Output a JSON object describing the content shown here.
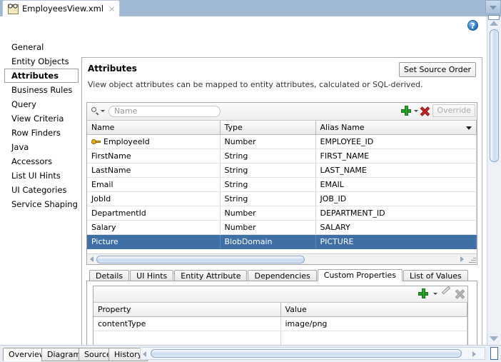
{
  "window": {
    "document_tab": {
      "label": "EmployeesView.xml",
      "icon": "view-object-icon",
      "close_label": "×"
    },
    "help_label": "?"
  },
  "sidebar": {
    "items": [
      {
        "label": "General",
        "selected": false
      },
      {
        "label": "Entity Objects",
        "selected": false
      },
      {
        "label": "Attributes",
        "selected": true
      },
      {
        "label": "Business Rules",
        "selected": false
      },
      {
        "label": "Query",
        "selected": false
      },
      {
        "label": "View Criteria",
        "selected": false
      },
      {
        "label": "Row Finders",
        "selected": false
      },
      {
        "label": "Java",
        "selected": false
      },
      {
        "label": "Accessors",
        "selected": false
      },
      {
        "label": "List UI Hints",
        "selected": false
      },
      {
        "label": "UI Categories",
        "selected": false
      },
      {
        "label": "Service Shaping",
        "selected": false
      }
    ]
  },
  "panel": {
    "title": "Attributes",
    "description": "View object attributes can be mapped to entity attributes, calculated or SQL-derived.",
    "set_source_order_label": "Set Source Order"
  },
  "attributes_toolbar": {
    "search_placeholder": "Name",
    "search_value": "",
    "add_label": "+",
    "delete_label": "×",
    "override_label": "Override",
    "override_enabled": false
  },
  "attributes_table": {
    "columns": [
      "Name",
      "Type",
      "Alias Name"
    ],
    "rows": [
      {
        "name": "EmployeeId",
        "type": "Number",
        "alias": "EMPLOYEE_ID",
        "key": true,
        "selected": false
      },
      {
        "name": "FirstName",
        "type": "String",
        "alias": "FIRST_NAME",
        "key": false,
        "selected": false
      },
      {
        "name": "LastName",
        "type": "String",
        "alias": "LAST_NAME",
        "key": false,
        "selected": false
      },
      {
        "name": "Email",
        "type": "String",
        "alias": "EMAIL",
        "key": false,
        "selected": false
      },
      {
        "name": "JobId",
        "type": "String",
        "alias": "JOB_ID",
        "key": false,
        "selected": false
      },
      {
        "name": "DepartmentId",
        "type": "Number",
        "alias": "DEPARTMENT_ID",
        "key": false,
        "selected": false
      },
      {
        "name": "Salary",
        "type": "Number",
        "alias": "SALARY",
        "key": false,
        "selected": false
      },
      {
        "name": "Picture",
        "type": "BlobDomain",
        "alias": "PICTURE",
        "key": false,
        "selected": true
      }
    ]
  },
  "detail_tabs": [
    {
      "label": "Details",
      "active": false
    },
    {
      "label": "UI Hints",
      "active": false
    },
    {
      "label": "Entity Attribute",
      "active": false
    },
    {
      "label": "Dependencies",
      "active": false
    },
    {
      "label": "Custom Properties",
      "active": true
    },
    {
      "label": "List of Values",
      "active": false
    }
  ],
  "custom_properties": {
    "toolbar": {
      "add_label": "+",
      "edit_label": "edit",
      "delete_label": "×",
      "delete_enabled": false
    },
    "columns": [
      "Property",
      "Value"
    ],
    "rows": [
      {
        "property": "contentType",
        "value": "image/png"
      }
    ]
  },
  "bottom_tabs": [
    {
      "label": "Overview",
      "active": true
    },
    {
      "label": "Diagram",
      "active": false
    },
    {
      "label": "Source",
      "active": false
    },
    {
      "label": "History",
      "active": false
    }
  ],
  "colors": {
    "window_chrome": "#a8bdd4",
    "selection_blue": "#3f6fa5",
    "add_green": "#2aa32a",
    "delete_red": "#d22a2a",
    "key_yellow": "#e8b010",
    "help_blue": "#2e7fc4"
  }
}
